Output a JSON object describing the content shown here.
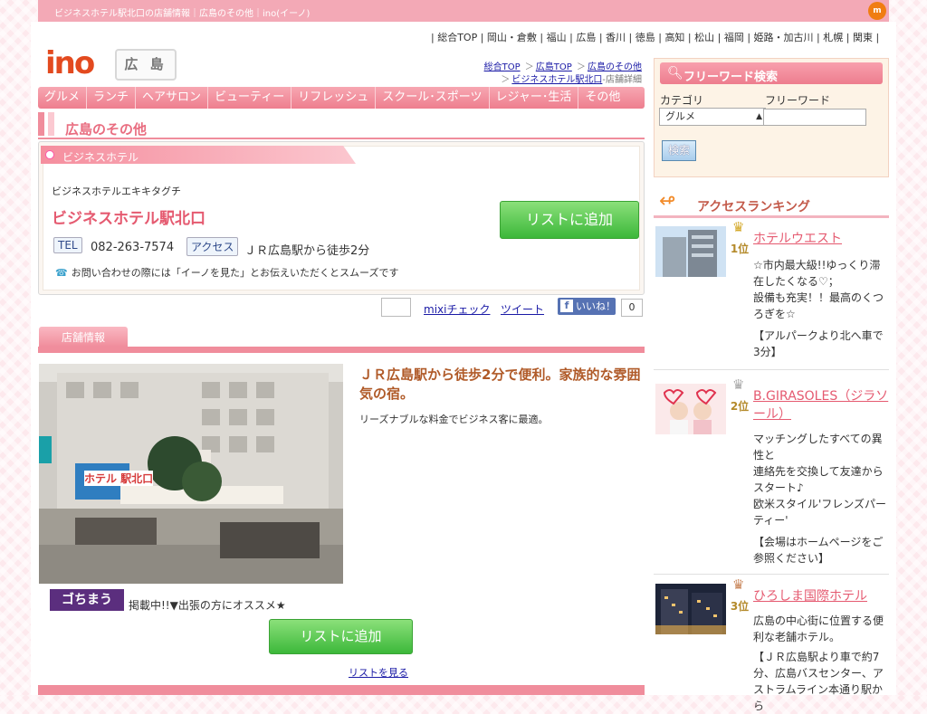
{
  "topbar": {
    "breadcrumb": "ビジネスホテル駅北口の店舗情報｜広島のその他｜ino(イーノ)",
    "badge": "m"
  },
  "regions": [
    "総合TOP",
    "岡山・倉敷",
    "福山",
    "広島",
    "香川",
    "徳島",
    "高知",
    "松山",
    "福岡",
    "姫路・加古川",
    "札幌",
    "関東"
  ],
  "logo": {
    "text": "ino",
    "city": "広 島"
  },
  "crumbs": {
    "top": "総合TOP",
    "city": "広島TOP",
    "category": "広島のその他",
    "shop": "ビジネスホテル駅北口",
    "suffix": "-店舗詳細"
  },
  "nav": [
    "グルメ",
    "ランチ",
    "ヘアサロン",
    "ビューティー",
    "リフレッシュ",
    "スクール･スポーツ",
    "レジャー･生活",
    "その他"
  ],
  "section_title": "広島のその他",
  "shop": {
    "category": "ビジネスホテル",
    "kana": "ビジネスホテルエキキタグチ",
    "name": "ビジネスホテル駅北口",
    "tel_label": "TEL",
    "tel": "082-263-7574",
    "access_label": "アクセス",
    "access": "ＪＲ広島駅から徒歩2分",
    "inquiry": "お問い合わせの際には「イーノを見た」とお伝えいただくとスムーズです",
    "add_list": "リストに追加"
  },
  "social": {
    "mixi": "mixiチェック",
    "tweet": "ツイート",
    "like": "いいね！",
    "like_count": "0"
  },
  "tab": "店舗情報",
  "detail": {
    "catch": "ＪＲ広島駅から徒歩2分で便利。家族的な雰囲気の宿。",
    "desc": "リーズナブルな料金でビジネス客に最適。",
    "photo_sign": "ホテル 駅北口",
    "gochi_logo": "ゴちまう",
    "gochi_text": "掲載中!!▼出張の方にオススメ★",
    "add_list": "リストに追加",
    "view_list": "リストを見る"
  },
  "search": {
    "title": "フリーワード検索",
    "category_label": "カテゴリ",
    "category_value": "グルメ",
    "free_label": "フリーワード",
    "button": "検索"
  },
  "ranking": {
    "title": "アクセスランキング",
    "items": [
      {
        "rank": "1位",
        "name": "ホテルウエスト",
        "desc": [
          "☆市内最大級!!ゆっくり滞在したくなる♡；",
          "設備も充実！！最高のくつろぎを☆"
        ],
        "note": "【アルパークより北へ車で3分】"
      },
      {
        "rank": "2位",
        "name": "B.GIRASOLES（ジラソール）",
        "desc": [
          "マッチングしたすべての異性と",
          "連絡先を交換して友達からスタート♪",
          "欧米スタイル'フレンズパーティー'"
        ],
        "note": "【会場はホームページをご参照ください】"
      },
      {
        "rank": "3位",
        "name": "ひろしま国際ホテル",
        "desc": [
          "広島の中心街に位置する便利な老舗ホテル。",
          "【ＪＲ広島駅より車で約7分、広島バスセンター、アストラムライン本通り駅から"
        ],
        "note": ""
      }
    ]
  }
}
